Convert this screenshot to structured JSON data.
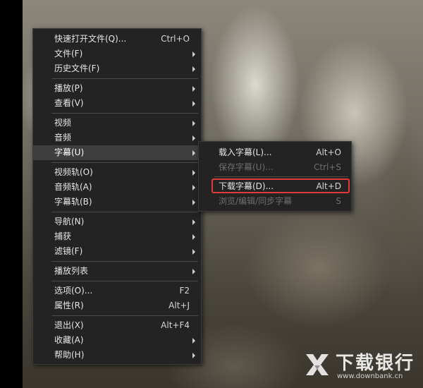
{
  "main_menu": {
    "items": [
      {
        "label": "快速打开文件(Q)...",
        "shortcut": "Ctrl+O",
        "submenu": false
      },
      {
        "label": "文件(F)",
        "shortcut": "",
        "submenu": true
      },
      {
        "label": "历史文件(F)",
        "shortcut": "",
        "submenu": true
      },
      {
        "label": "播放(P)",
        "shortcut": "",
        "submenu": true
      },
      {
        "label": "查看(V)",
        "shortcut": "",
        "submenu": true
      },
      {
        "label": "视频",
        "shortcut": "",
        "submenu": true
      },
      {
        "label": "音频",
        "shortcut": "",
        "submenu": true
      },
      {
        "label": "字幕(U)",
        "shortcut": "",
        "submenu": true,
        "highlighted": true
      },
      {
        "label": "视频轨(O)",
        "shortcut": "",
        "submenu": true
      },
      {
        "label": "音频轨(A)",
        "shortcut": "",
        "submenu": true
      },
      {
        "label": "字幕轨(B)",
        "shortcut": "",
        "submenu": true
      },
      {
        "label": "导航(N)",
        "shortcut": "",
        "submenu": true
      },
      {
        "label": "捕获",
        "shortcut": "",
        "submenu": true
      },
      {
        "label": "滤镜(F)",
        "shortcut": "",
        "submenu": true
      },
      {
        "label": "播放列表",
        "shortcut": "",
        "submenu": true
      },
      {
        "label": "选项(O)...",
        "shortcut": "F2",
        "submenu": false
      },
      {
        "label": "属性(R)",
        "shortcut": "Alt+J",
        "submenu": false
      },
      {
        "label": "退出(X)",
        "shortcut": "Alt+F4",
        "submenu": false
      },
      {
        "label": "收藏(A)",
        "shortcut": "",
        "submenu": true
      },
      {
        "label": "帮助(H)",
        "shortcut": "",
        "submenu": true
      }
    ]
  },
  "subtitle_menu": {
    "items": [
      {
        "label": "载入字幕(L)...",
        "shortcut": "Alt+O",
        "disabled": false
      },
      {
        "label": "保存字幕(U)...",
        "shortcut": "Ctrl+S",
        "disabled": true
      },
      {
        "label": "下载字幕(D)...",
        "shortcut": "Alt+D",
        "disabled": false,
        "outlined": true
      },
      {
        "label": "浏览/编辑/同步字幕",
        "shortcut": "S",
        "disabled": true
      }
    ]
  },
  "watermark": {
    "title": "下载银行",
    "url": "www.downbank.cn"
  },
  "colors": {
    "menu_bg": "#232323",
    "highlight_bg": "#3e3e3e",
    "outline_red": "#e23a3a"
  }
}
